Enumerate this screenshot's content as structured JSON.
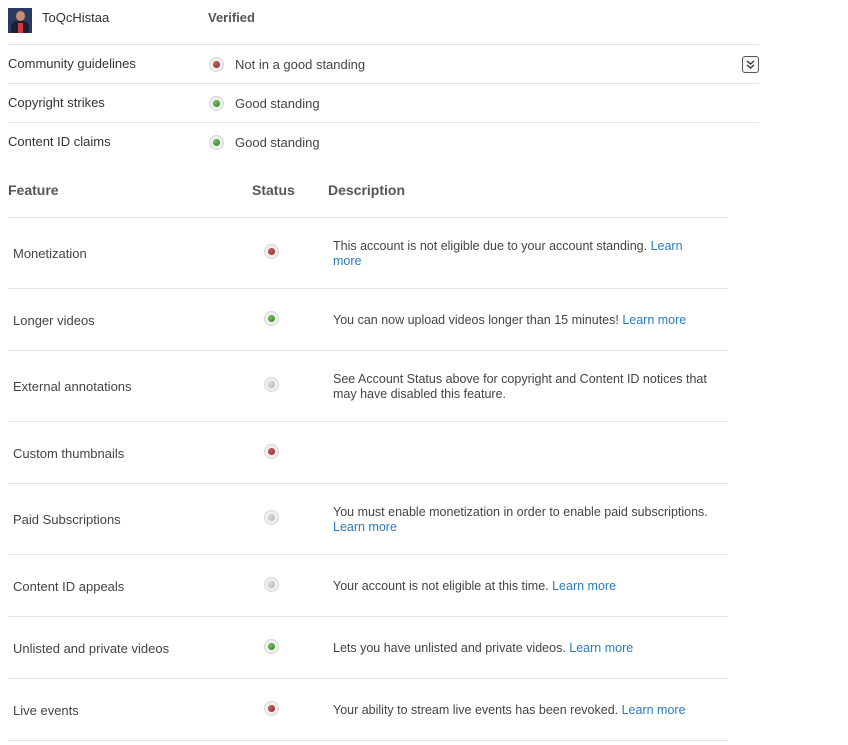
{
  "header": {
    "channel_name": "ToQcHistaa",
    "verified_label": "Verified"
  },
  "account_status": [
    {
      "label": "Community guidelines",
      "status": "red",
      "value": "Not in a good standing"
    },
    {
      "label": "Copyright strikes",
      "status": "green",
      "value": "Good standing"
    },
    {
      "label": "Content ID claims",
      "status": "green",
      "value": "Good standing"
    }
  ],
  "table": {
    "headers": {
      "feature": "Feature",
      "status": "Status",
      "description": "Description"
    },
    "rows": [
      {
        "feature": "Monetization",
        "status": "red",
        "description": "This account is not eligible due to your account standing. ",
        "link": "Learn more"
      },
      {
        "feature": "Longer videos",
        "status": "green",
        "description": "You can now upload videos longer than 15 minutes! ",
        "link": "Learn more"
      },
      {
        "feature": "External annotations",
        "status": "gray",
        "description": "See Account Status above for copyright and Content ID notices that may have disabled this feature.",
        "link": ""
      },
      {
        "feature": "Custom thumbnails",
        "status": "red",
        "description": "",
        "link": ""
      },
      {
        "feature": "Paid Subscriptions",
        "status": "gray",
        "description": "You must enable monetization in order to enable paid subscriptions. ",
        "link": "Learn more"
      },
      {
        "feature": "Content ID appeals",
        "status": "gray",
        "description": "Your account is not eligible at this time. ",
        "link": "Learn more"
      },
      {
        "feature": "Unlisted and private videos",
        "status": "green",
        "description": "Lets you have unlisted and private videos. ",
        "link": "Learn more"
      },
      {
        "feature": "Live events",
        "status": "red",
        "description": "Your ability to stream live events has been revoked. ",
        "link": "Learn more"
      }
    ]
  },
  "colors": {
    "link": "#2a7ac0",
    "red": "#8a2424",
    "green": "#2f7f22",
    "gray": "#b4b4b4"
  }
}
